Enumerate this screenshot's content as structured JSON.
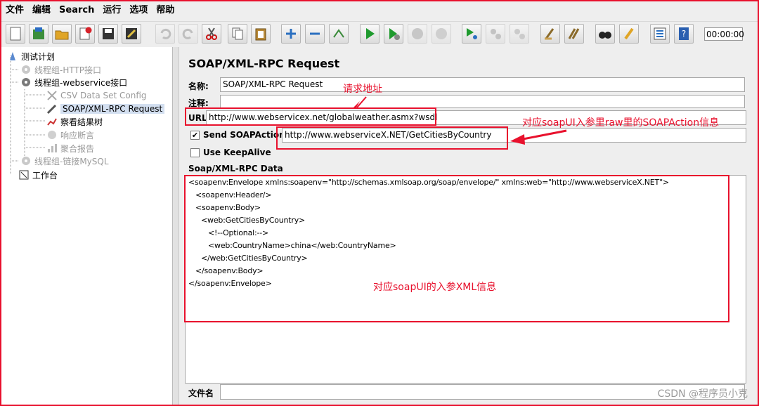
{
  "menu": [
    "文件",
    "编辑",
    "Search",
    "运行",
    "选项",
    "帮助"
  ],
  "toolbar": {
    "timer": "00:00:00",
    "icons": [
      "new-icon",
      "templates-icon",
      "open-icon",
      "close-icon",
      "save-icon",
      "save-as-icon",
      "undo-icon",
      "redo-icon",
      "cut-icon",
      "copy-icon",
      "paste-icon",
      "expand-icon",
      "collapse-icon",
      "toggle-icon",
      "start-icon",
      "start-no-pause-icon",
      "stop-icon",
      "shutdown-icon",
      "remote-start-icon",
      "remote-stop-icon",
      "remote-shutdown-icon",
      "clear-icon",
      "clear-all-icon",
      "search-icon",
      "reset-search-icon",
      "function-helper-icon",
      "help-icon"
    ]
  },
  "tree": {
    "items": [
      {
        "label": "测试计划"
      },
      {
        "label": "线程组-HTTP接口"
      },
      {
        "label": "线程组-webservice接口"
      },
      {
        "label": "CSV Data Set Config"
      },
      {
        "label": "SOAP/XML-RPC Request"
      },
      {
        "label": "察看结果树"
      },
      {
        "label": "响应断言"
      },
      {
        "label": "聚合报告"
      },
      {
        "label": "线程组-链接MySQL"
      },
      {
        "label": "工作台"
      }
    ]
  },
  "panel": {
    "title": "SOAP/XML-RPC Request",
    "name_label": "名称:",
    "name_value": "SOAP/XML-RPC Request",
    "comment_label": "注释:",
    "comment_value": "",
    "url_label": "URL",
    "url_value": "http://www.webservicex.net/globalweather.asmx?wsdl",
    "send_soapaction_label": "Send SOAPAction:",
    "send_soapaction_checked": true,
    "soapaction_value": "http://www.webserviceX.NET/GetCitiesByCountry",
    "keepalive_label": "Use KeepAlive",
    "keepalive_checked": false,
    "data_label": "Soap/XML-RPC Data",
    "xml_lines": [
      "<soapenv:Envelope xmlns:soapenv=\"http://schemas.xmlsoap.org/soap/envelope/\" xmlns:web=\"http://www.webserviceX.NET\">",
      "<soapenv:Header/>",
      "<soapenv:Body>",
      "<web:GetCitiesByCountry>",
      "<!--Optional:-->",
      "<web:CountryName>china</web:CountryName>",
      "</web:GetCitiesByCountry>",
      "</soapenv:Body>",
      "</soapenv:Envelope>"
    ],
    "file_label": "文件名",
    "file_value": ""
  },
  "annotations": {
    "url_note": "请求地址",
    "soapaction_note": "对应soapUI入参里raw里的SOAPAction信息",
    "xml_note": "对应soapUI的入参XML信息",
    "accent": "#e8112d"
  },
  "watermark": "CSDN @程序员小克"
}
